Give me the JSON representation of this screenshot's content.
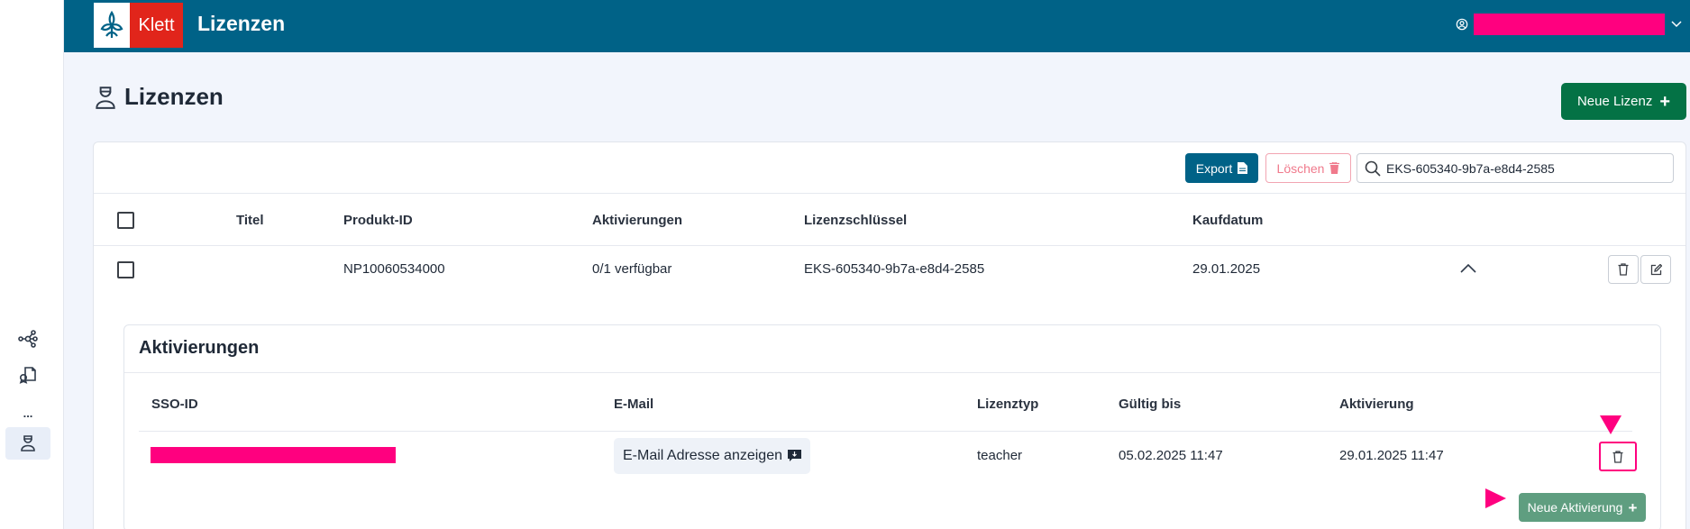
{
  "header": {
    "logo_text": "Klett",
    "title": "Lizenzen",
    "user_name_redacted": true
  },
  "sidebar": {
    "items": [
      {
        "icon": "network-icon"
      },
      {
        "icon": "documents-icon"
      },
      {
        "icon": "more-icon",
        "label": "..."
      },
      {
        "icon": "license-user-icon",
        "active": true
      }
    ]
  },
  "page": {
    "title": "Lizenzen",
    "new_license_label": "Neue Lizenz"
  },
  "toolbar": {
    "export_label": "Export",
    "delete_label": "Löschen",
    "search_value": "EKS-605340-9b7a-e8d4-2585"
  },
  "table": {
    "columns": [
      "Titel",
      "Produkt-ID",
      "Aktivierungen",
      "Lizenzschlüssel",
      "Kaufdatum"
    ],
    "rows": [
      {
        "titel": "",
        "produkt_id": "NP10060534000",
        "aktivierungen": "0/1 verfügbar",
        "lizenzschluessel": "EKS-605340-9b7a-e8d4-2585",
        "kaufdatum": "29.01.2025",
        "expanded": true
      }
    ]
  },
  "activations": {
    "title": "Aktivierungen",
    "columns": [
      "SSO-ID",
      "E-Mail",
      "Lizenztyp",
      "Gültig bis",
      "Aktivierung"
    ],
    "rows": [
      {
        "sso_id_redacted": true,
        "email_button_label": "E-Mail Adresse anzeigen",
        "lizenztyp": "teacher",
        "gueltig_bis": "05.02.2025 11:47",
        "aktivierung": "29.01.2025 11:47"
      }
    ],
    "new_activation_label": "Neue Aktivierung"
  },
  "colors": {
    "header_bg": "#006287",
    "primary_green": "#047245",
    "export_blue": "#006287",
    "highlight_magenta": "#ff007f",
    "delete_pink": "#f07a8c"
  }
}
